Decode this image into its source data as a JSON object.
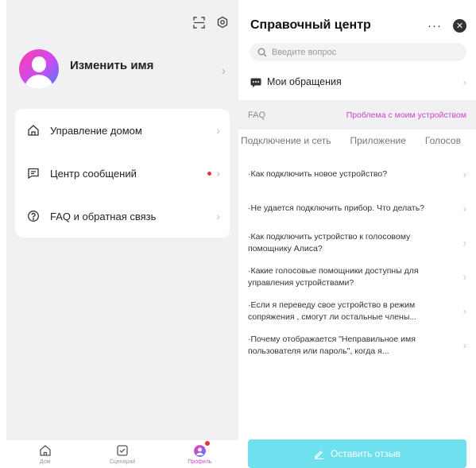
{
  "profile": {
    "name": "Изменить имя"
  },
  "menu": [
    {
      "icon": "home-icon",
      "label": "Управление домом",
      "badge": false
    },
    {
      "icon": "message-icon",
      "label": "Центр сообщений",
      "badge": true
    },
    {
      "icon": "question-icon",
      "label": "FAQ и обратная связь",
      "badge": false
    }
  ],
  "bottom_nav": {
    "items": [
      {
        "icon": "home-icon",
        "label": "Дом",
        "active": false
      },
      {
        "icon": "scenario-icon",
        "label": "Сценарий",
        "active": false
      },
      {
        "icon": "profile-icon",
        "label": "Профиль",
        "active": true
      }
    ]
  },
  "help": {
    "title": "Справочный центр",
    "more": "···",
    "close": "✕",
    "search_placeholder": "Введите вопрос",
    "requests_label": "Мои обращения",
    "faq_label": "FAQ",
    "faq_link": "Проблема с моим устройством",
    "categories": [
      "Подключение и сеть",
      "Приложение",
      "Голосов"
    ],
    "questions": [
      "·Как подключить новое устройство?",
      "·Не удается подключить прибор. Что делать?",
      "·Как подключить устройство к голосовому помощнику Алиса?",
      "·Какие голосовые помощники доступны для управления устройствами?",
      "·Если я переведу свое устройство в режим сопряжения , смогут ли остальные члены...",
      "·Почему отображается \"Неправильное имя пользователя или пароль\", когда я..."
    ],
    "feedback_button": "Оставить отзыв"
  },
  "colors": {
    "accent_pink": "#cc44c8",
    "feedback_button": "#6ee0ee",
    "badge_red": "#e53935"
  }
}
